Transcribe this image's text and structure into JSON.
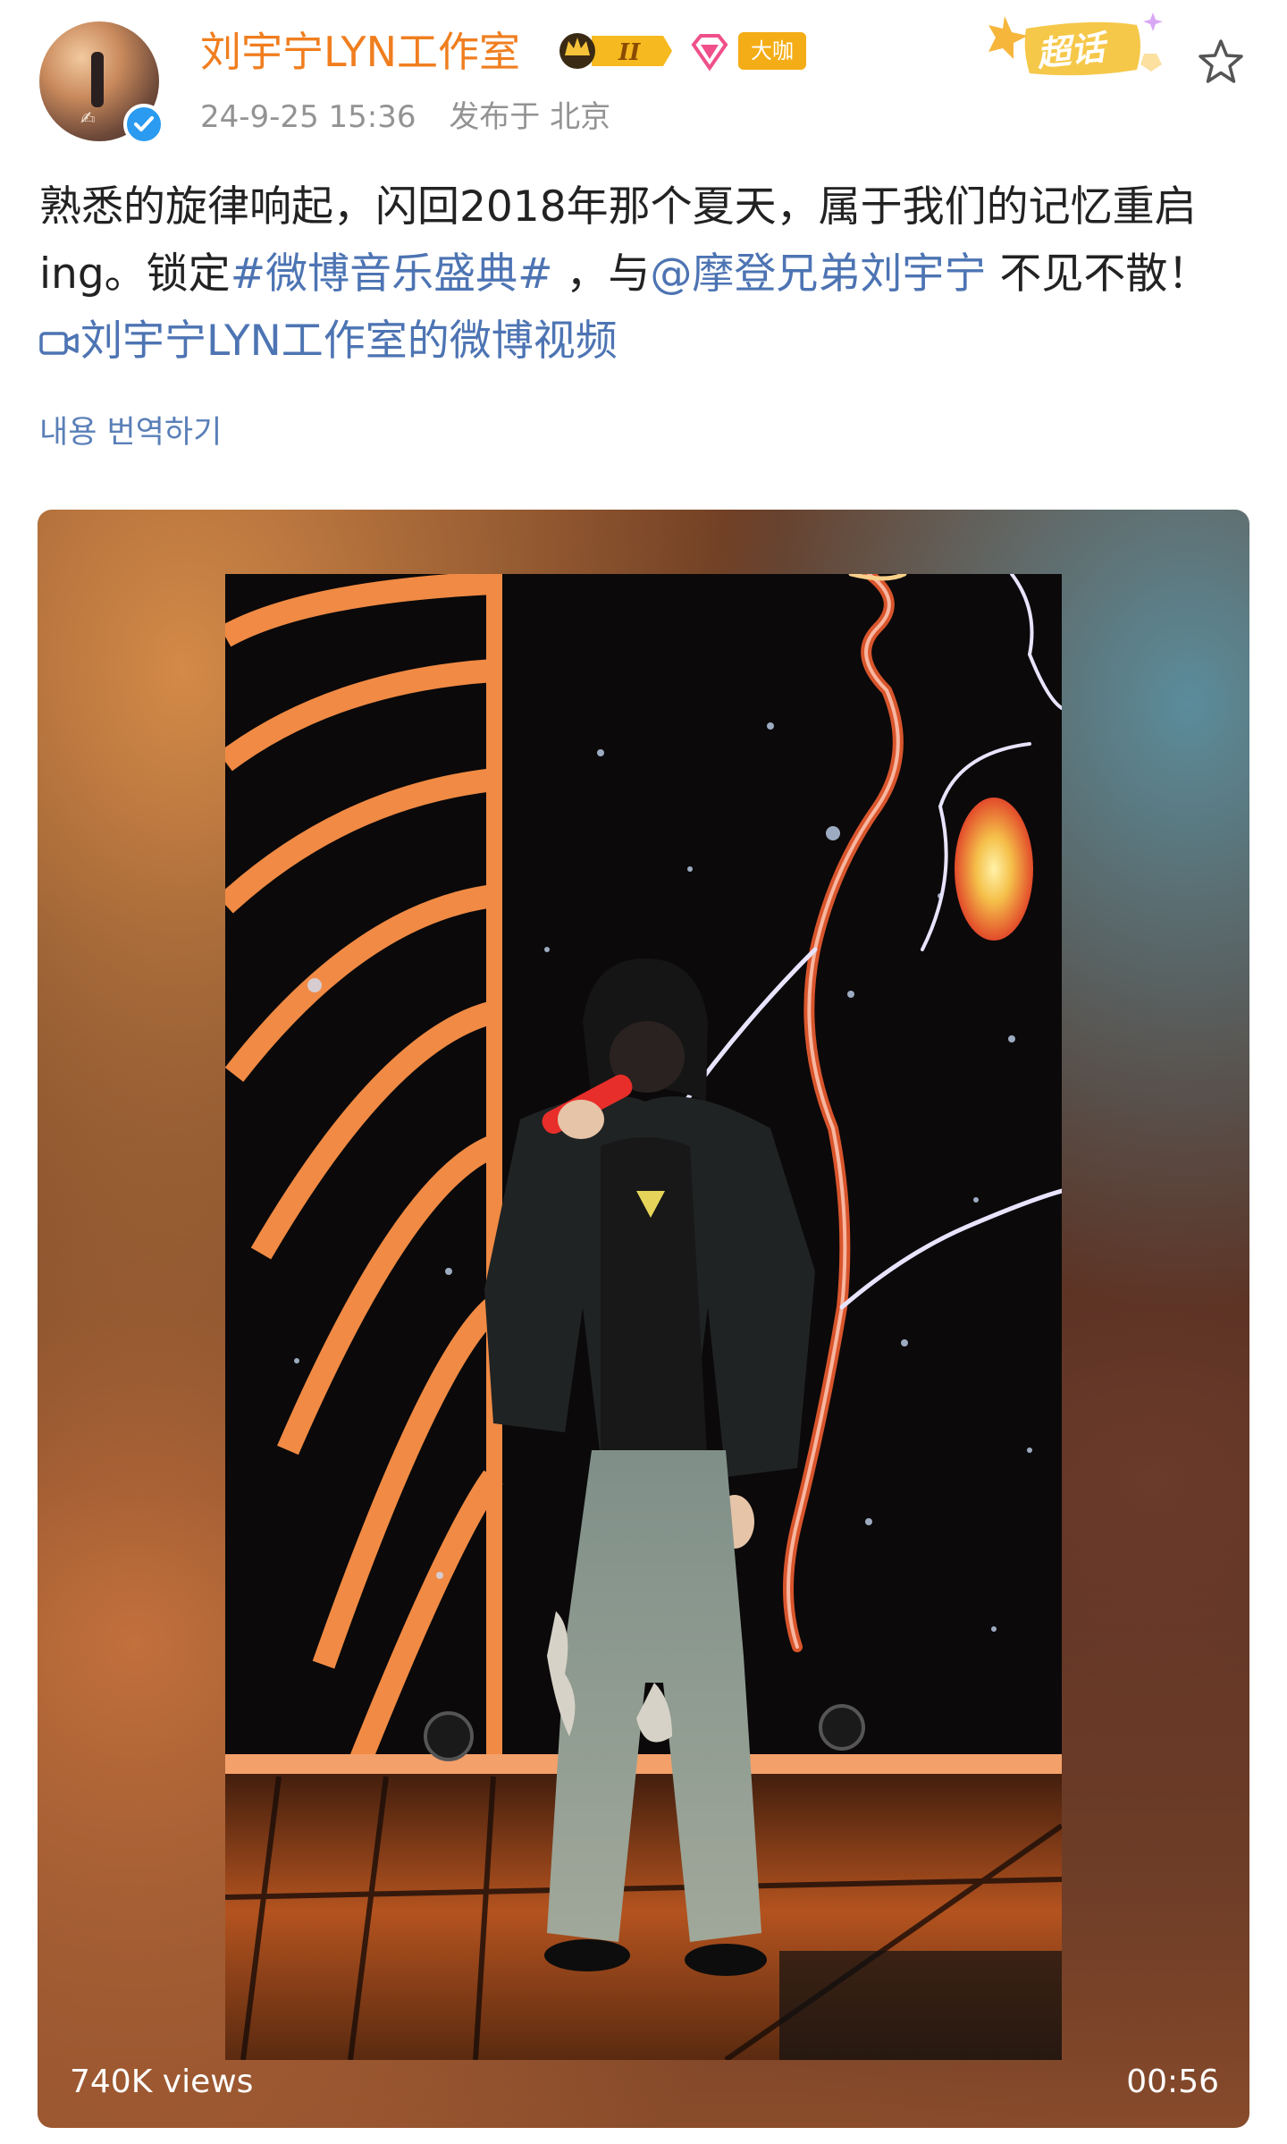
{
  "author": {
    "name": "刘宇宁LYN工作室",
    "badge_level": "II",
    "tag": "大咖"
  },
  "meta": {
    "date": "24-9-25 15:36",
    "location": "发布于 北京"
  },
  "chaohua": {
    "label": "超话"
  },
  "post": {
    "text_part1": "熟悉的旋律响起，闪回2018年那个夏天，属于我们的记忆重启ing。锁定",
    "hashtag": "#微博音乐盛典#",
    "text_part2": " ，与",
    "mention": "@摩登兄弟刘宇宁",
    "text_part3": " 不见不散！ ",
    "video_link": "刘宇宁LYN工作室的微博视频"
  },
  "translate_label": "내용 번역하기",
  "video": {
    "views": "740K views",
    "duration": "00:56"
  },
  "colors": {
    "name": "#f07e1f",
    "link": "#4d74b3",
    "verify": "#2a9bf0",
    "tag_bg": "#f4ad16"
  },
  "icons": {
    "verify": "verified-check-icon",
    "crown": "crown-icon",
    "fan": "diamond-fan-icon",
    "chaohua": "chaohua-sparkle-icon",
    "favorite": "star-outline-icon",
    "video_link": "video-link-icon"
  }
}
